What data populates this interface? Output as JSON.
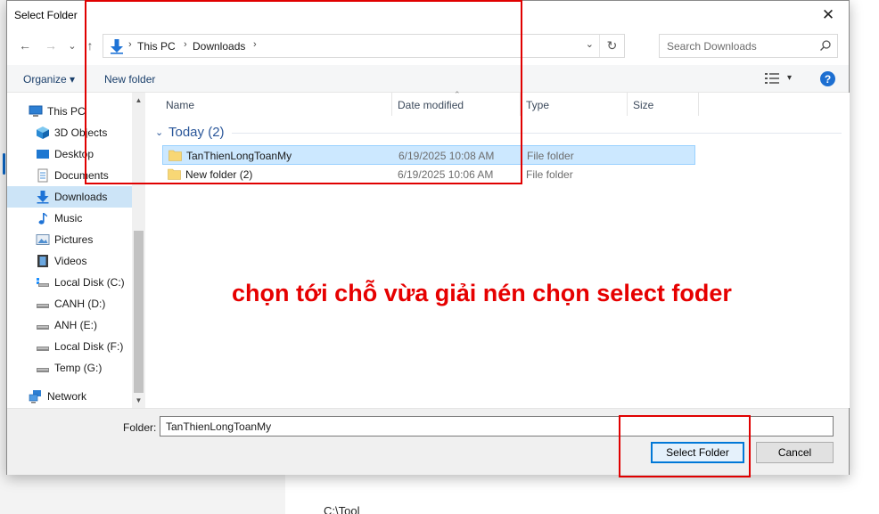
{
  "background": {
    "path_text": "C:\\Tool"
  },
  "dialog": {
    "title": "Select Folder",
    "close_glyph": "✕",
    "address": {
      "crumbs": [
        "This PC",
        "Downloads"
      ],
      "separator": "›",
      "dropdown_glyph": "⌄",
      "refresh_glyph": "↻"
    },
    "search": {
      "placeholder": "Search Downloads"
    },
    "nav_glyphs": {
      "back": "←",
      "forward": "→",
      "recent": "⌄",
      "up": "↑"
    },
    "toolbar": {
      "organize": "Organize ▾",
      "new_folder": "New folder",
      "view_dropdown": "▾",
      "help": "?"
    },
    "nav_pane": {
      "items": [
        {
          "label": "This PC",
          "icon": "pc-icon"
        },
        {
          "label": "3D Objects",
          "icon": "cube-icon"
        },
        {
          "label": "Desktop",
          "icon": "desktop-icon"
        },
        {
          "label": "Documents",
          "icon": "documents-icon"
        },
        {
          "label": "Downloads",
          "icon": "download-icon",
          "selected": true
        },
        {
          "label": "Music",
          "icon": "music-icon"
        },
        {
          "label": "Pictures",
          "icon": "pictures-icon"
        },
        {
          "label": "Videos",
          "icon": "videos-icon"
        },
        {
          "label": "Local Disk (C:)",
          "icon": "os-drive-icon"
        },
        {
          "label": "CANH (D:)",
          "icon": "drive-icon"
        },
        {
          "label": "ANH (E:)",
          "icon": "drive-icon"
        },
        {
          "label": "Local Disk (F:)",
          "icon": "drive-icon"
        },
        {
          "label": "Temp (G:)",
          "icon": "drive-icon"
        },
        {
          "label": "Network",
          "icon": "network-icon"
        }
      ],
      "scroll_up": "▲",
      "scroll_down": "▼"
    },
    "columns": {
      "name": "Name",
      "date_modified": "Date modified",
      "type": "Type",
      "size": "Size",
      "sort_caret": "⌃"
    },
    "group": {
      "title": "Today (2)",
      "chevron": "⌄"
    },
    "files": [
      {
        "name": "TanThienLongToanMy",
        "date": "6/19/2025 10:08 AM",
        "type": "File folder",
        "selected": true
      },
      {
        "name": "New folder (2)",
        "date": "6/19/2025 10:06 AM",
        "type": "File folder",
        "selected": false
      }
    ],
    "annotation": "chọn tới chỗ vừa giải nén chọn select foder",
    "folder_label": "Folder:",
    "folder_value": "TanThienLongToanMy",
    "buttons": {
      "select": "Select Folder",
      "cancel": "Cancel"
    }
  },
  "colors": {
    "accent": "#0078d7",
    "annotation_red": "#e60000",
    "selection": "#cce8ff",
    "folder_yellow": "#f8d775"
  }
}
